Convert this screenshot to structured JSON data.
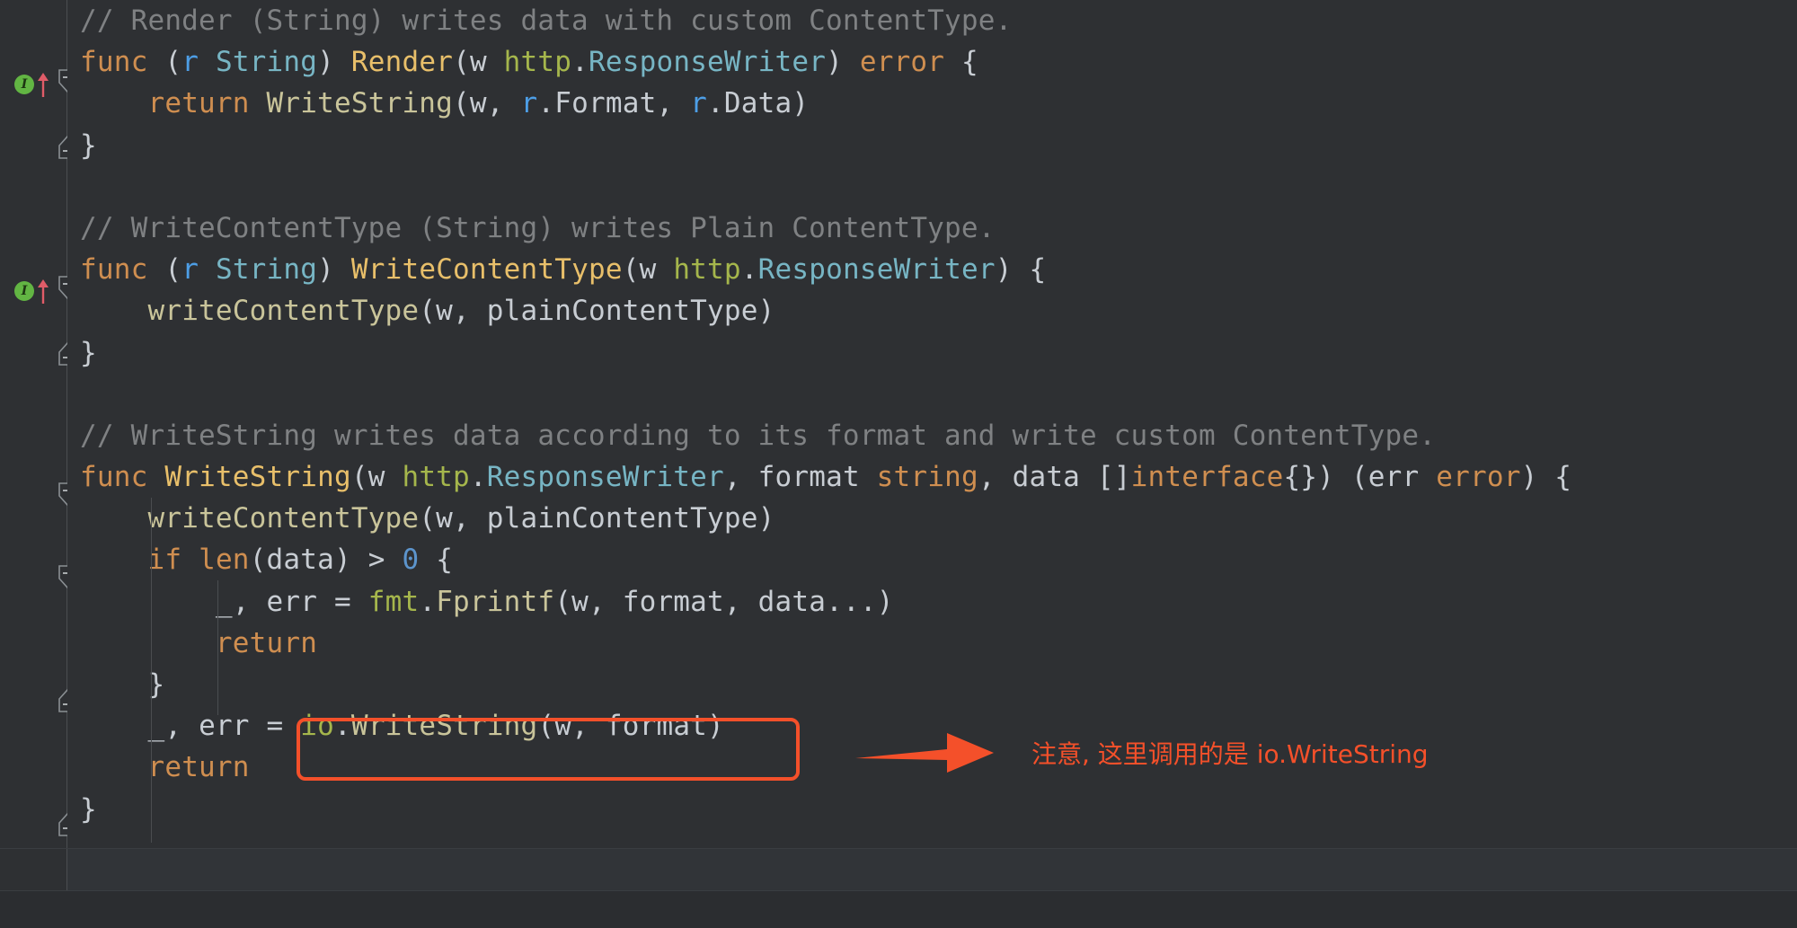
{
  "editor": {
    "theme_name": "darcula",
    "background": "#2e3033",
    "gutter_background": "#2e3033",
    "colors": {
      "keyword": "#cf8e50",
      "function_declaration": "#e8bf6a",
      "function_call": "#c9c49a",
      "type": "#77b5c4",
      "receiver": "#4d9ee6",
      "package": "#a5b64c",
      "number": "#5c94cc",
      "plain_text": "#c8cdd3",
      "comment": "#7f8183",
      "annotation": "#f4502a",
      "implements_marker": "#62b543",
      "override_arrow": "#e05c68"
    },
    "lines": [
      {
        "id": "l1",
        "tokens": [
          {
            "t": "// Render (String) writes data with custom ContentType.",
            "c": "com"
          }
        ]
      },
      {
        "id": "l2",
        "tokens": [
          {
            "t": "func",
            "c": "kw"
          },
          {
            "t": " (",
            "c": "punct"
          },
          {
            "t": "r",
            "c": "recv"
          },
          {
            "t": " ",
            "c": "plain"
          },
          {
            "t": "String",
            "c": "typ"
          },
          {
            "t": ") ",
            "c": "punct"
          },
          {
            "t": "Render",
            "c": "fn"
          },
          {
            "t": "(",
            "c": "punct"
          },
          {
            "t": "w ",
            "c": "plain"
          },
          {
            "t": "http",
            "c": "pkg"
          },
          {
            "t": ".",
            "c": "punct"
          },
          {
            "t": "ResponseWriter",
            "c": "typ"
          },
          {
            "t": ") ",
            "c": "punct"
          },
          {
            "t": "error",
            "c": "kw"
          },
          {
            "t": " {",
            "c": "punct"
          }
        ]
      },
      {
        "id": "l3",
        "tokens": [
          {
            "t": "    ",
            "c": "plain"
          },
          {
            "t": "return",
            "c": "kw"
          },
          {
            "t": " ",
            "c": "plain"
          },
          {
            "t": "WriteString",
            "c": "call"
          },
          {
            "t": "(",
            "c": "punct"
          },
          {
            "t": "w",
            "c": "plain"
          },
          {
            "t": ", ",
            "c": "punct"
          },
          {
            "t": "r",
            "c": "recv"
          },
          {
            "t": ".Format",
            "c": "plain"
          },
          {
            "t": ", ",
            "c": "punct"
          },
          {
            "t": "r",
            "c": "recv"
          },
          {
            "t": ".Data",
            "c": "plain"
          },
          {
            "t": ")",
            "c": "punct"
          }
        ]
      },
      {
        "id": "l4",
        "tokens": [
          {
            "t": "}",
            "c": "punct"
          }
        ]
      },
      {
        "id": "l5",
        "tokens": [
          {
            "t": "",
            "c": "plain"
          }
        ]
      },
      {
        "id": "l6",
        "tokens": [
          {
            "t": "// WriteContentType (String) writes Plain ContentType.",
            "c": "com"
          }
        ]
      },
      {
        "id": "l7",
        "tokens": [
          {
            "t": "func",
            "c": "kw"
          },
          {
            "t": " (",
            "c": "punct"
          },
          {
            "t": "r",
            "c": "recv"
          },
          {
            "t": " ",
            "c": "plain"
          },
          {
            "t": "String",
            "c": "typ"
          },
          {
            "t": ") ",
            "c": "punct"
          },
          {
            "t": "WriteContentType",
            "c": "fn"
          },
          {
            "t": "(",
            "c": "punct"
          },
          {
            "t": "w ",
            "c": "plain"
          },
          {
            "t": "http",
            "c": "pkg"
          },
          {
            "t": ".",
            "c": "punct"
          },
          {
            "t": "ResponseWriter",
            "c": "typ"
          },
          {
            "t": ") {",
            "c": "punct"
          }
        ]
      },
      {
        "id": "l8",
        "tokens": [
          {
            "t": "    ",
            "c": "plain"
          },
          {
            "t": "writeContentType",
            "c": "call"
          },
          {
            "t": "(",
            "c": "punct"
          },
          {
            "t": "w",
            "c": "plain"
          },
          {
            "t": ", ",
            "c": "punct"
          },
          {
            "t": "plainContentType",
            "c": "plain"
          },
          {
            "t": ")",
            "c": "punct"
          }
        ]
      },
      {
        "id": "l9",
        "tokens": [
          {
            "t": "}",
            "c": "punct"
          }
        ]
      },
      {
        "id": "l10",
        "tokens": [
          {
            "t": "",
            "c": "plain"
          }
        ]
      },
      {
        "id": "l11",
        "tokens": [
          {
            "t": "// WriteString writes data according to its format and write custom ContentType.",
            "c": "com"
          }
        ]
      },
      {
        "id": "l12",
        "tokens": [
          {
            "t": "func",
            "c": "kw"
          },
          {
            "t": " ",
            "c": "plain"
          },
          {
            "t": "WriteString",
            "c": "fn"
          },
          {
            "t": "(",
            "c": "punct"
          },
          {
            "t": "w ",
            "c": "plain"
          },
          {
            "t": "http",
            "c": "pkg"
          },
          {
            "t": ".",
            "c": "punct"
          },
          {
            "t": "ResponseWriter",
            "c": "typ"
          },
          {
            "t": ", ",
            "c": "punct"
          },
          {
            "t": "format ",
            "c": "plain"
          },
          {
            "t": "string",
            "c": "kw"
          },
          {
            "t": ", ",
            "c": "punct"
          },
          {
            "t": "data ",
            "c": "plain"
          },
          {
            "t": "[]",
            "c": "punct"
          },
          {
            "t": "interface",
            "c": "kw"
          },
          {
            "t": "{}) (",
            "c": "punct"
          },
          {
            "t": "err ",
            "c": "plain"
          },
          {
            "t": "error",
            "c": "kw"
          },
          {
            "t": ") {",
            "c": "punct"
          }
        ]
      },
      {
        "id": "l13",
        "tokens": [
          {
            "t": "    ",
            "c": "plain"
          },
          {
            "t": "writeContentType",
            "c": "call"
          },
          {
            "t": "(",
            "c": "punct"
          },
          {
            "t": "w",
            "c": "plain"
          },
          {
            "t": ", ",
            "c": "punct"
          },
          {
            "t": "plainContentType",
            "c": "plain"
          },
          {
            "t": ")",
            "c": "punct"
          }
        ]
      },
      {
        "id": "l14",
        "tokens": [
          {
            "t": "    ",
            "c": "plain"
          },
          {
            "t": "if",
            "c": "kw"
          },
          {
            "t": " ",
            "c": "plain"
          },
          {
            "t": "len",
            "c": "bi"
          },
          {
            "t": "(",
            "c": "punct"
          },
          {
            "t": "data",
            "c": "plain"
          },
          {
            "t": ") > ",
            "c": "punct"
          },
          {
            "t": "0",
            "c": "num"
          },
          {
            "t": " {",
            "c": "punct"
          }
        ]
      },
      {
        "id": "l15",
        "tokens": [
          {
            "t": "        ",
            "c": "plain"
          },
          {
            "t": "_",
            "c": "plain"
          },
          {
            "t": ", ",
            "c": "punct"
          },
          {
            "t": "err",
            "c": "plain"
          },
          {
            "t": " = ",
            "c": "punct"
          },
          {
            "t": "fmt",
            "c": "pkg"
          },
          {
            "t": ".",
            "c": "punct"
          },
          {
            "t": "Fprintf",
            "c": "call"
          },
          {
            "t": "(",
            "c": "punct"
          },
          {
            "t": "w",
            "c": "plain"
          },
          {
            "t": ", ",
            "c": "punct"
          },
          {
            "t": "format",
            "c": "plain"
          },
          {
            "t": ", ",
            "c": "punct"
          },
          {
            "t": "data",
            "c": "plain"
          },
          {
            "t": "...)",
            "c": "punct"
          }
        ]
      },
      {
        "id": "l16",
        "tokens": [
          {
            "t": "        ",
            "c": "plain"
          },
          {
            "t": "return",
            "c": "kw"
          }
        ]
      },
      {
        "id": "l17",
        "tokens": [
          {
            "t": "    }",
            "c": "punct"
          }
        ]
      },
      {
        "id": "l18",
        "tokens": [
          {
            "t": "    ",
            "c": "plain"
          },
          {
            "t": "_",
            "c": "plain"
          },
          {
            "t": ", ",
            "c": "punct"
          },
          {
            "t": "err",
            "c": "plain"
          },
          {
            "t": " = ",
            "c": "punct"
          },
          {
            "t": "io",
            "c": "pkg"
          },
          {
            "t": ".",
            "c": "punct"
          },
          {
            "t": "WriteString",
            "c": "call"
          },
          {
            "t": "(",
            "c": "punct"
          },
          {
            "t": "w",
            "c": "plain"
          },
          {
            "t": ", ",
            "c": "punct"
          },
          {
            "t": "format",
            "c": "plain"
          },
          {
            "t": ")",
            "c": "punct"
          }
        ]
      },
      {
        "id": "l19",
        "tokens": [
          {
            "t": "    ",
            "c": "plain"
          },
          {
            "t": "return",
            "c": "kw"
          }
        ]
      },
      {
        "id": "l20",
        "tokens": [
          {
            "t": "}",
            "c": "punct"
          }
        ]
      }
    ]
  },
  "gutter": {
    "implements_markers": [
      {
        "label": "I",
        "tooltip": "Implements interface method",
        "line": 2
      },
      {
        "label": "I",
        "tooltip": "Implements interface method",
        "line": 7
      }
    ],
    "fold_markers": [
      {
        "state": "expanded",
        "line": 2
      },
      {
        "state": "expanded",
        "line": 4
      },
      {
        "state": "expanded",
        "line": 7
      },
      {
        "state": "expanded",
        "line": 9
      },
      {
        "state": "expanded",
        "line": 12
      },
      {
        "state": "expanded",
        "line": 14
      },
      {
        "state": "expanded",
        "line": 17
      },
      {
        "state": "expanded",
        "line": 20
      }
    ]
  },
  "annotation": {
    "highlight_box_label": "io.WriteString(w, format)",
    "arrow_label": "arrow pointing right",
    "note_text": "注意, 这里调用的是 io.WriteString",
    "color": "#f4502a"
  }
}
